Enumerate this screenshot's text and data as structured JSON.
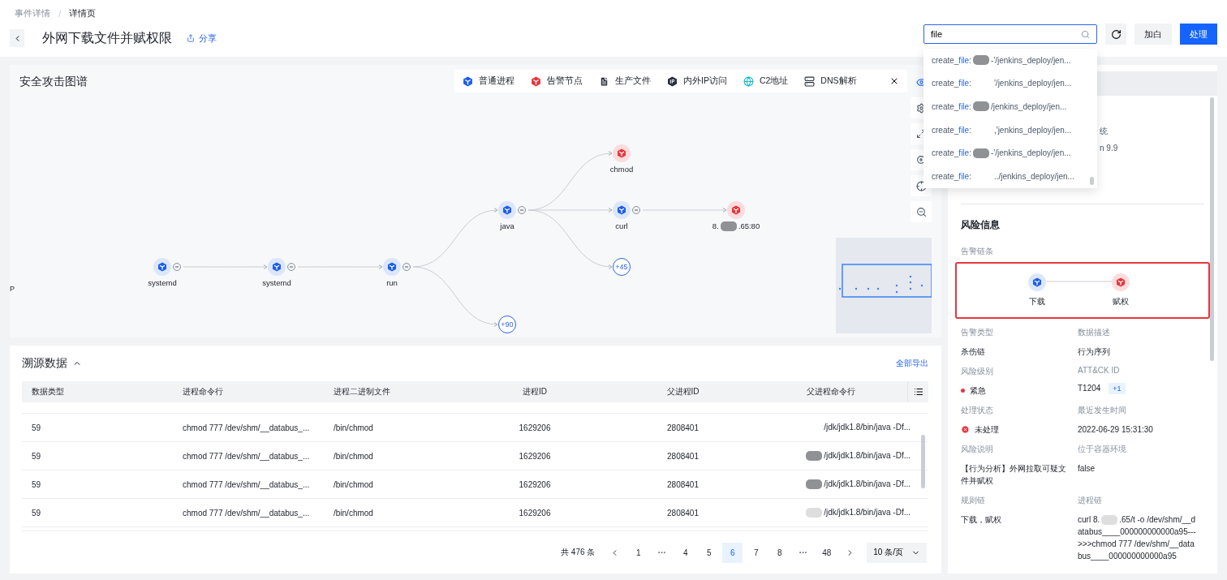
{
  "breadcrumb": [
    {
      "label": "事件详情",
      "current": false
    },
    {
      "label": "详情页",
      "current": true
    }
  ],
  "breadcrumb_separator": "/",
  "title": "外网下载文件并赋权限",
  "share": "分享",
  "search": {
    "value": "file"
  },
  "actions": [
    {
      "kind": "icon"
    },
    {
      "kind": "secondary",
      "label": "加白"
    },
    {
      "kind": "primary",
      "label": "处理"
    }
  ],
  "suggestions": [
    {
      "prefix": "create_",
      "match": "file",
      "sep": ":",
      "masked": true,
      "path": "-'/jenkins_deploy/jen..."
    },
    {
      "prefix": "create_",
      "match": "file",
      "sep": ":",
      "masked": false,
      "path": "'/jenkins_deploy/jen..."
    },
    {
      "prefix": "create_",
      "match": "file",
      "sep": ":",
      "masked": true,
      "path": "/jenkins_deploy/jen..."
    },
    {
      "prefix": "create_",
      "match": "file",
      "sep": ":",
      "masked": false,
      "path": ",'jenkins_deploy/jen..."
    },
    {
      "prefix": "create_",
      "match": "file",
      "sep": ":",
      "masked": true,
      "path": "-'/jenkins_deploy/jen..."
    },
    {
      "prefix": "create_",
      "match": "file",
      "sep": ":",
      "masked": false,
      "path": "../jenkins_deploy/jen..."
    }
  ],
  "graph": {
    "title": "安全攻击图谱",
    "side_mark": "P",
    "legend": [
      {
        "kind": "process",
        "label": "普通进程"
      },
      {
        "kind": "alert",
        "label": "告警节点"
      },
      {
        "kind": "file",
        "label": "生产文件"
      },
      {
        "kind": "ip",
        "label": "内外IP访问"
      },
      {
        "kind": "c2",
        "label": "C2地址"
      },
      {
        "kind": "dns",
        "label": "DNS解析"
      }
    ],
    "nodes": [
      {
        "kind": "process",
        "label": "systemd",
        "children": [
          {
            "kind": "process",
            "label": "systemd",
            "children": [
              {
                "kind": "process",
                "label": "run",
                "children": [
                  {
                    "kind": "process",
                    "label": "java",
                    "children": [
                      {
                        "kind": "alert",
                        "label": "chmod"
                      },
                      {
                        "kind": "process",
                        "label": "curl",
                        "children": [
                          {
                            "kind": "alert",
                            "label": "8.",
                            "label_tail": ".65:80",
                            "masked": true
                          }
                        ]
                      },
                      {
                        "kind": "more",
                        "label": "+45"
                      }
                    ]
                  },
                  {
                    "kind": "more",
                    "label": "+90"
                  }
                ]
              }
            ]
          }
        ]
      }
    ]
  },
  "table": {
    "title": "溯源数据",
    "export": "全部导出",
    "columns": [
      "数据类型",
      "进程命令行",
      "进程二进制文件",
      "进程ID",
      "父进程ID",
      "父进程命令行"
    ],
    "rows": [
      {
        "type": "59",
        "cmd": "chmod 777 /dev/shm/__databus_...",
        "binary": "/bin/chmod",
        "pid": "1629206",
        "ppid": "2808401",
        "masked": false,
        "parent_cmd": "/jdk/jdk1.8/bin/java -Df..."
      },
      {
        "type": "59",
        "cmd": "chmod 777 /dev/shm/__databus_...",
        "binary": "/bin/chmod",
        "pid": "1629206",
        "ppid": "2808401",
        "masked": true,
        "color": "#8f9195",
        "parent_cmd": "/jdk/jdk1.8/bin/java -Df..."
      },
      {
        "type": "59",
        "cmd": "chmod 777 /dev/shm/__databus_...",
        "binary": "/bin/chmod",
        "pid": "1629206",
        "ppid": "2808401",
        "masked": true,
        "color": "#8f9195",
        "parent_cmd": "/jdk/jdk1.8/bin/java -Df..."
      },
      {
        "type": "59",
        "cmd": "chmod 777 /dev/shm/__databus_...",
        "binary": "/bin/chmod",
        "pid": "1629206",
        "ppid": "2808401",
        "masked": true,
        "color": "#dedede",
        "parent_cmd": "/jdk/jdk1.8/bin/java -Df..."
      }
    ],
    "total": "共 476 条",
    "pages": [
      {
        "kind": "page",
        "label": "1",
        "selected": false
      },
      {
        "kind": "ellipsis",
        "label": "···",
        "selected": false
      },
      {
        "kind": "page",
        "label": "4",
        "selected": false
      },
      {
        "kind": "page",
        "label": "5",
        "selected": false
      },
      {
        "kind": "page",
        "label": "6",
        "selected": true
      },
      {
        "kind": "page",
        "label": "7",
        "selected": false
      },
      {
        "kind": "page",
        "label": "8",
        "selected": false
      },
      {
        "kind": "ellipsis",
        "label": "···",
        "selected": false
      },
      {
        "kind": "page",
        "label": "48",
        "selected": false
      }
    ],
    "page_size": "10 条/页"
  },
  "panel": {
    "fragments": [
      "统",
      "n 9.9"
    ],
    "section": "风险信息",
    "chain_label": "告警链条",
    "chain": [
      {
        "kind": "process",
        "label": "下载"
      },
      {
        "kind": "alert",
        "label": "赋权"
      }
    ],
    "fields": [
      {
        "kind": "text",
        "label": "告警类型",
        "value": "杀伤链"
      },
      {
        "kind": "text",
        "label": "数据描述",
        "value": "行为序列"
      },
      {
        "kind": "level",
        "label": "风险级别",
        "value": "紧急",
        "color": "#e5373d"
      },
      {
        "kind": "tag",
        "label": "ATT&CK ID",
        "value": "T1204",
        "tag": "+1"
      },
      {
        "kind": "status",
        "label": "处理状态",
        "value": "未处理"
      },
      {
        "kind": "text",
        "label": "最近发生时间",
        "value": "2022-06-29 15:31:30"
      },
      {
        "kind": "text",
        "label": "风险说明",
        "value": "【行为分析】外网拉取可疑文件并赋权"
      },
      {
        "kind": "text",
        "label": "位于容器环境",
        "value": "false"
      },
      {
        "kind": "text",
        "label": "规则链",
        "value": "下载，赋权"
      },
      {
        "kind": "masked",
        "label": "进程链",
        "value": "curl 8.",
        "value_tail": ".65/t -o /dev/shm/__databus____000000000000a95--->>>chmod 777 /dev/shm/__databus____000000000000a95"
      }
    ]
  }
}
